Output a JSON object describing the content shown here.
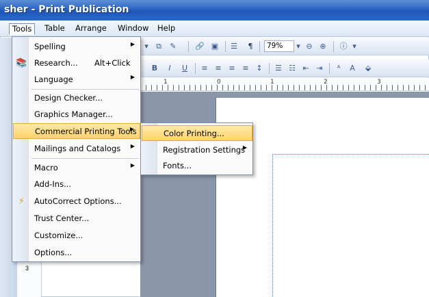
{
  "window": {
    "title": "sher - Print Publication"
  },
  "menubar": {
    "items": [
      {
        "label": "Tools"
      },
      {
        "label": "Table"
      },
      {
        "label": "Arrange"
      },
      {
        "label": "Window"
      },
      {
        "label": "Help"
      }
    ]
  },
  "toolbar": {
    "zoom_value": "79%",
    "format_buttons": [
      "B",
      "I",
      "U"
    ]
  },
  "ruler": {
    "labels": [
      "1",
      "0",
      "1",
      "2",
      "3"
    ],
    "vertical_label": "3"
  },
  "tools_menu": {
    "items": [
      {
        "label": "Spelling",
        "has_submenu": true
      },
      {
        "label": "Research...",
        "shortcut": "Alt+Click",
        "icon": "research-icon"
      },
      {
        "label": "Language",
        "has_submenu": true
      },
      {
        "label": "Design Checker..."
      },
      {
        "label": "Graphics Manager..."
      },
      {
        "label": "Commercial Printing Tools",
        "has_submenu": true,
        "highlighted": true
      },
      {
        "label": "Mailings and Catalogs",
        "has_submenu": true
      },
      {
        "label": "Macro",
        "has_submenu": true
      },
      {
        "label": "Add-Ins..."
      },
      {
        "label": "AutoCorrect Options...",
        "icon": "lightning-icon"
      },
      {
        "label": "Trust Center..."
      },
      {
        "label": "Customize..."
      },
      {
        "label": "Options..."
      }
    ]
  },
  "commercial_printing_submenu": {
    "items": [
      {
        "label": "Color Printing...",
        "highlighted": true
      },
      {
        "label": "Registration Settings",
        "has_submenu": true
      },
      {
        "label": "Fonts..."
      }
    ]
  },
  "colors": {
    "titlebar": "#2a64c5",
    "highlight": "#ffd36d",
    "workspace": "#8a97aa"
  }
}
